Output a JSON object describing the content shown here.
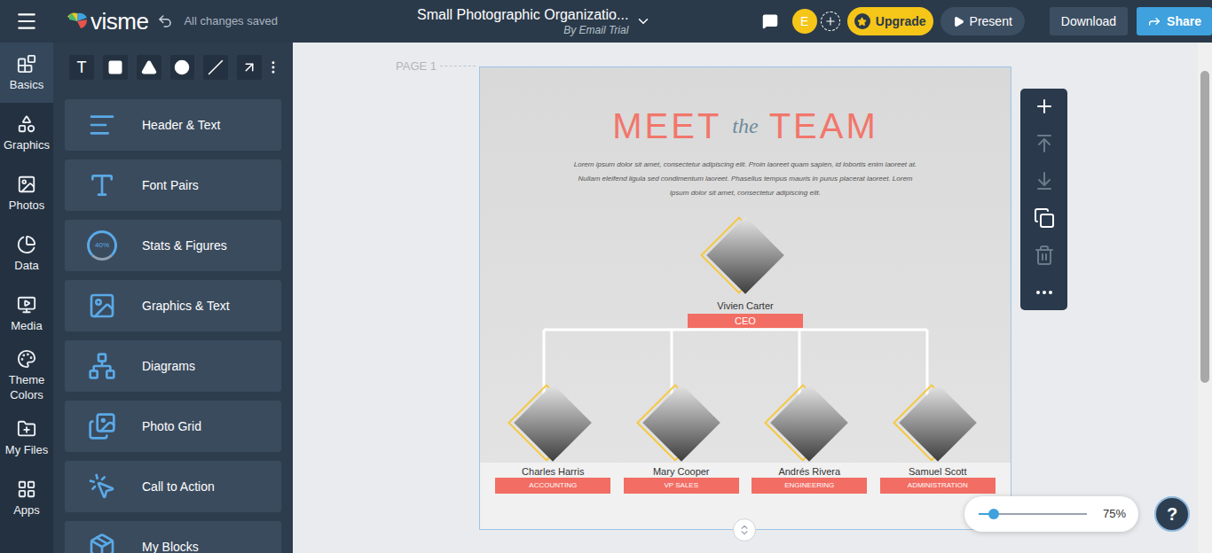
{
  "topbar": {
    "logo": "visme",
    "save_status": "All changes saved",
    "document_title": "Small Photographic Organizatio...",
    "author": "By Email Trial",
    "avatar": "E",
    "buttons": [
      {
        "label": "Upgrade",
        "kind": "upgrade"
      },
      {
        "label": "Present",
        "kind": "present"
      },
      {
        "label": "Download",
        "kind": "download"
      },
      {
        "label": "Share",
        "kind": "share"
      }
    ]
  },
  "rail": [
    {
      "label": "Basics",
      "selected": true
    },
    {
      "label": "Graphics",
      "selected": false
    },
    {
      "label": "Photos",
      "selected": false
    },
    {
      "label": "Data",
      "selected": false
    },
    {
      "label": "Media",
      "selected": false
    },
    {
      "label": "Theme Colors",
      "selected": false
    },
    {
      "label": "My Files",
      "selected": false
    },
    {
      "label": "Apps",
      "selected": false
    }
  ],
  "tools": [
    {
      "kind": "text",
      "label": "T"
    },
    {
      "kind": "rectangle"
    },
    {
      "kind": "triangle"
    },
    {
      "kind": "circle"
    },
    {
      "kind": "line"
    },
    {
      "kind": "arrow"
    },
    {
      "kind": "more"
    }
  ],
  "blocks": [
    {
      "label": "Header & Text",
      "kind": "header"
    },
    {
      "label": "Font Pairs",
      "kind": "font"
    },
    {
      "label": "Stats & Figures",
      "kind": "stats",
      "figure": "40%"
    },
    {
      "label": "Graphics & Text",
      "kind": "graphics"
    },
    {
      "label": "Diagrams",
      "kind": "diagram"
    },
    {
      "label": "Photo Grid",
      "kind": "grid"
    },
    {
      "label": "Call to Action",
      "kind": "cta"
    },
    {
      "label": "My Blocks",
      "kind": "mine"
    }
  ],
  "page": {
    "label": "PAGE 1",
    "heading": {
      "first": "MEET",
      "middle": "the",
      "last": "TEAM"
    },
    "body": [
      "Lorem ipsum dolor sit amet, consectetur adipiscing elit. Proin laoreet quam sapien, id lobortis enim laoreet at.",
      "Nullam eleifend ligula sed condimentum laoreet. Phasellus tempus mauris in purus placerat laoreet. Lorem",
      "ipsum dolor sit amet, consectetur adipiscing elit."
    ],
    "ceo": {
      "name": "Vivien Carter",
      "role": "CEO"
    },
    "team": [
      {
        "name": "Charles Harris",
        "role": "ACCOUNTING"
      },
      {
        "name": "Mary Cooper",
        "role": "VP SALES"
      },
      {
        "name": "Andrés Rivera",
        "role": "ENGINEERING"
      },
      {
        "name": "Samuel Scott",
        "role": "ADMINISTRATION"
      }
    ]
  },
  "object_toolbar": [
    {
      "kind": "add",
      "disabled": false
    },
    {
      "kind": "move-up",
      "disabled": true
    },
    {
      "kind": "move-down",
      "disabled": true
    },
    {
      "kind": "duplicate",
      "disabled": false
    },
    {
      "kind": "delete",
      "disabled": true
    },
    {
      "kind": "more",
      "disabled": false
    }
  ],
  "zoom": {
    "level": 0.14,
    "reading": "75%"
  },
  "help": "?"
}
